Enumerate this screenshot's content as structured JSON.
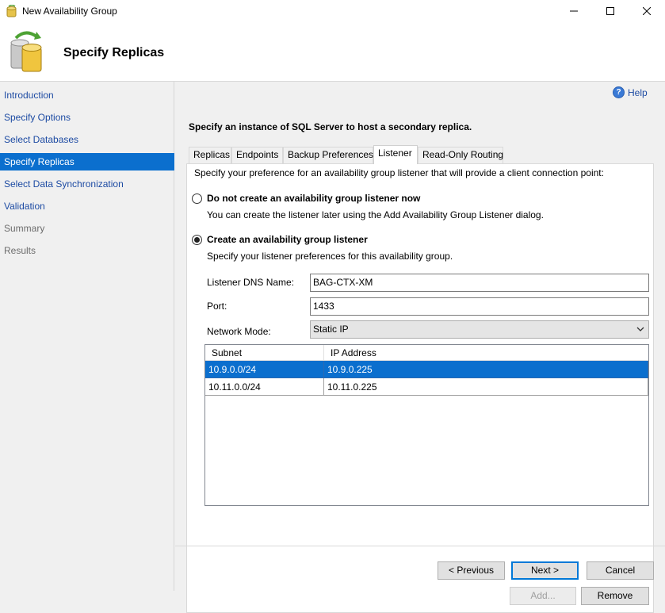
{
  "window": {
    "title": "New Availability Group"
  },
  "banner": {
    "title": "Specify Replicas"
  },
  "nav": {
    "items": [
      {
        "label": "Introduction",
        "state": "link"
      },
      {
        "label": "Specify Options",
        "state": "link"
      },
      {
        "label": "Select Databases",
        "state": "link"
      },
      {
        "label": "Specify Replicas",
        "state": "active"
      },
      {
        "label": "Select Data Synchronization",
        "state": "link"
      },
      {
        "label": "Validation",
        "state": "link"
      },
      {
        "label": "Summary",
        "state": "disabled"
      },
      {
        "label": "Results",
        "state": "disabled"
      }
    ]
  },
  "help": {
    "label": "Help"
  },
  "instruction": "Specify an instance of SQL Server to host a secondary replica.",
  "tabs": [
    {
      "label": "Replicas"
    },
    {
      "label": "Endpoints"
    },
    {
      "label": "Backup Preferences"
    },
    {
      "label": "Listener",
      "active": true
    },
    {
      "label": "Read-Only Routing"
    }
  ],
  "listener": {
    "description": "Specify your preference for an availability group listener that will provide a client connection point:",
    "option_none": {
      "label": "Do not create an availability group listener now",
      "hint": "You can create the listener later using the Add Availability Group Listener dialog.",
      "selected": false
    },
    "option_create": {
      "label": "Create an availability group listener",
      "hint": "Specify your listener preferences for this availability group.",
      "selected": true
    },
    "dns_name": {
      "label": "Listener DNS Name:",
      "value": "BAG-CTX-XM"
    },
    "port": {
      "label": "Port:",
      "value": "1433"
    },
    "network_mode": {
      "label": "Network Mode:",
      "value": "Static IP"
    },
    "grid": {
      "columns": [
        "Subnet",
        "IP Address"
      ],
      "rows": [
        {
          "subnet": "10.9.0.0/24",
          "ip": "10.9.0.225",
          "selected": true
        },
        {
          "subnet": "10.11.0.0/24",
          "ip": "10.11.0.225",
          "selected": false
        }
      ]
    },
    "add_label": "Add...",
    "remove_label": "Remove"
  },
  "footer": {
    "previous_label": "< Previous",
    "next_label": "Next >",
    "cancel_label": "Cancel"
  },
  "colors": {
    "accent": "#0b6fce",
    "link": "#1d4ba3"
  }
}
